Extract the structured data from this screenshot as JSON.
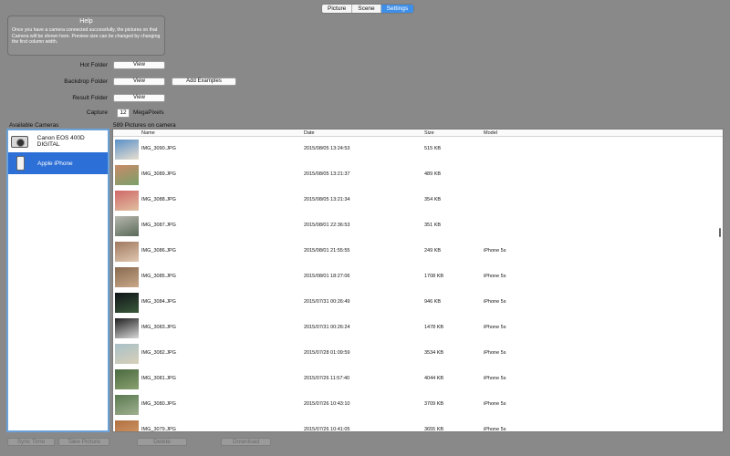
{
  "tabs": [
    {
      "label": "Picture",
      "active": false
    },
    {
      "label": "Scene",
      "active": false
    },
    {
      "label": "Settings",
      "active": true
    }
  ],
  "help": {
    "title": "Help",
    "text": "Once you have a camera connected successfully, the pictures on that Camera will be shown here. Preview size can be changed by changing the first column width."
  },
  "settings": {
    "hot_folder_label": "Hot Folder",
    "backdrop_folder_label": "Backdrop Folder",
    "result_folder_label": "Result Folder",
    "capture_label": "Capture",
    "view_label": "View",
    "add_examples_label": "Add Examples",
    "capture_value": "12",
    "capture_unit": "MegaPixels"
  },
  "cameras": {
    "title": "Available Cameras",
    "items": [
      {
        "name": "Canon EOS 400D DIGITAL",
        "icon": "dslr-camera-icon",
        "selected": false
      },
      {
        "name": "Apple iPhone",
        "icon": "iphone-icon",
        "selected": true
      }
    ]
  },
  "pictures": {
    "title": "589 Pictures on camera",
    "columns": {
      "name": "Name",
      "date": "Date",
      "size": "Size",
      "model": "Model"
    },
    "rows": [
      {
        "name": "IMG_3090.JPG",
        "date": "2015/08/05 13:24:53",
        "size": "515 KB",
        "model": "",
        "c1": "#5a90c8",
        "c2": "#e8e0d0"
      },
      {
        "name": "IMG_3089.JPG",
        "date": "2015/08/05 13:21:37",
        "size": "489 KB",
        "model": "",
        "c1": "#c98a68",
        "c2": "#7aa06a"
      },
      {
        "name": "IMG_3088.JPG",
        "date": "2015/08/05 13:21:34",
        "size": "354 KB",
        "model": "",
        "c1": "#d06868",
        "c2": "#e0c0a0"
      },
      {
        "name": "IMG_3087.JPG",
        "date": "2015/08/01 22:36:53",
        "size": "351 KB",
        "model": "",
        "c1": "#b8b8b0",
        "c2": "#5a6a58"
      },
      {
        "name": "IMG_3086.JPG",
        "date": "2015/08/01 21:55:55",
        "size": "249 KB",
        "model": "iPhone 5s",
        "c1": "#a07860",
        "c2": "#e0c8b0"
      },
      {
        "name": "IMG_3085.JPG",
        "date": "2015/08/01 18:27:06",
        "size": "1708 KB",
        "model": "iPhone 5s",
        "c1": "#8a6a50",
        "c2": "#c8a888"
      },
      {
        "name": "IMG_3084.JPG",
        "date": "2015/07/31 00:26:49",
        "size": "946 KB",
        "model": "iPhone 5s",
        "c1": "#101418",
        "c2": "#3a5a3a"
      },
      {
        "name": "IMG_3083.JPG",
        "date": "2015/07/31 00:26:24",
        "size": "1478 KB",
        "model": "iPhone 5s",
        "c1": "#202020",
        "c2": "#d8d8d8"
      },
      {
        "name": "IMG_3082.JPG",
        "date": "2015/07/28 01:09:59",
        "size": "3534 KB",
        "model": "iPhone 5s",
        "c1": "#a8c0c8",
        "c2": "#d8d0b8"
      },
      {
        "name": "IMG_3081.JPG",
        "date": "2015/07/26 11:57:40",
        "size": "4044 KB",
        "model": "iPhone 5s",
        "c1": "#4a6a40",
        "c2": "#8aa070"
      },
      {
        "name": "IMG_3080.JPG",
        "date": "2015/07/26 10:43:10",
        "size": "3709 KB",
        "model": "iPhone 5s",
        "c1": "#5a7a50",
        "c2": "#a0b090"
      },
      {
        "name": "IMG_3079.JPG",
        "date": "2015/07/26 10:41:05",
        "size": "3655 KB",
        "model": "iPhone 5s",
        "c1": "#b07040",
        "c2": "#d8a070"
      }
    ]
  },
  "bottom": {
    "sync_time": "Sync Time",
    "take_picture": "Take Picture",
    "delete": "Delete",
    "download": "Download"
  }
}
